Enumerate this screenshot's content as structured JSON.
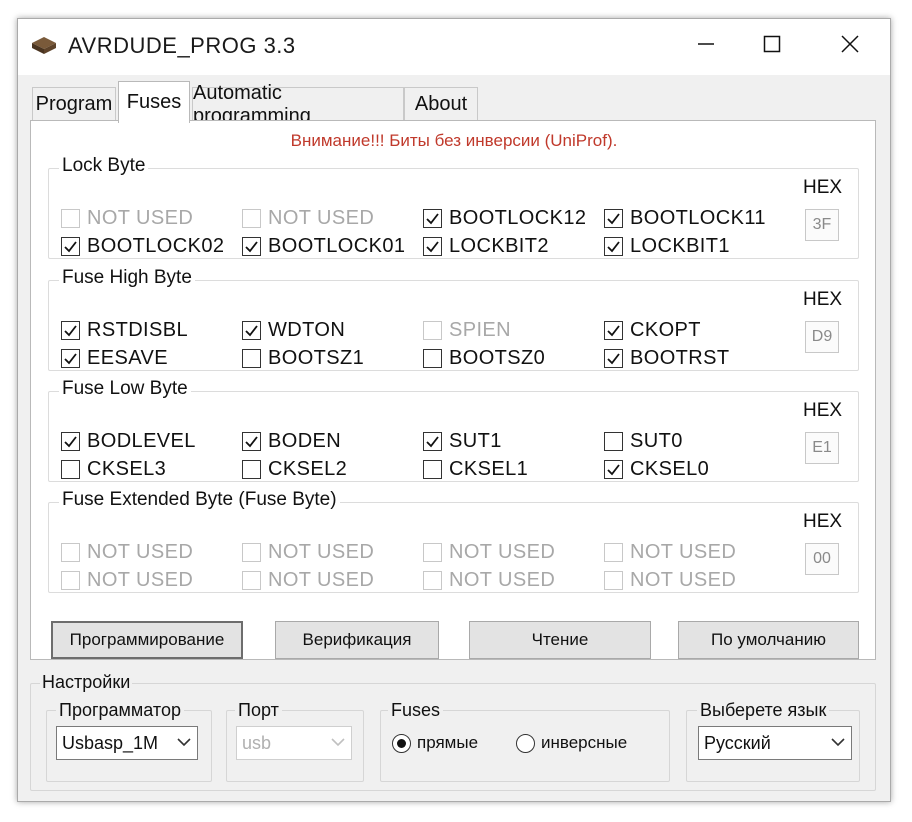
{
  "window": {
    "title": "AVRDUDE_PROG 3.3"
  },
  "tabs": [
    {
      "label": "Program"
    },
    {
      "label": "Fuses"
    },
    {
      "label": "Automatic programming"
    },
    {
      "label": "About"
    }
  ],
  "active_tab": "Fuses",
  "warning": "Внимание!!! Биты без инверсии (UniProf).",
  "hex_label": "HEX",
  "groups": {
    "lock": {
      "title": "Lock Byte",
      "hex": "3F",
      "items": [
        {
          "label": "NOT USED",
          "checked": false,
          "enabled": false
        },
        {
          "label": "NOT USED",
          "checked": false,
          "enabled": false
        },
        {
          "label": "BOOTLOCK12",
          "checked": true,
          "enabled": true
        },
        {
          "label": "BOOTLOCK11",
          "checked": true,
          "enabled": true
        },
        {
          "label": "BOOTLOCK02",
          "checked": true,
          "enabled": true
        },
        {
          "label": "BOOTLOCK01",
          "checked": true,
          "enabled": true
        },
        {
          "label": "LOCKBIT2",
          "checked": true,
          "enabled": true
        },
        {
          "label": "LOCKBIT1",
          "checked": true,
          "enabled": true
        }
      ]
    },
    "high": {
      "title": "Fuse High Byte",
      "hex": "D9",
      "items": [
        {
          "label": "RSTDISBL",
          "checked": true,
          "enabled": true
        },
        {
          "label": "WDTON",
          "checked": true,
          "enabled": true
        },
        {
          "label": "SPIEN",
          "checked": false,
          "enabled": false
        },
        {
          "label": "CKOPT",
          "checked": true,
          "enabled": true
        },
        {
          "label": "EESAVE",
          "checked": true,
          "enabled": true
        },
        {
          "label": "BOOTSZ1",
          "checked": false,
          "enabled": true
        },
        {
          "label": "BOOTSZ0",
          "checked": false,
          "enabled": true
        },
        {
          "label": "BOOTRST",
          "checked": true,
          "enabled": true
        }
      ]
    },
    "low": {
      "title": "Fuse Low Byte",
      "hex": "E1",
      "items": [
        {
          "label": "BODLEVEL",
          "checked": true,
          "enabled": true
        },
        {
          "label": "BODEN",
          "checked": true,
          "enabled": true
        },
        {
          "label": "SUT1",
          "checked": true,
          "enabled": true
        },
        {
          "label": "SUT0",
          "checked": false,
          "enabled": true
        },
        {
          "label": "CKSEL3",
          "checked": false,
          "enabled": true
        },
        {
          "label": "CKSEL2",
          "checked": false,
          "enabled": true
        },
        {
          "label": "CKSEL1",
          "checked": false,
          "enabled": true
        },
        {
          "label": "CKSEL0",
          "checked": true,
          "enabled": true
        }
      ]
    },
    "ext": {
      "title": "Fuse Extended Byte (Fuse Byte)",
      "hex": "00",
      "items": [
        {
          "label": "NOT USED",
          "checked": false,
          "enabled": false
        },
        {
          "label": "NOT USED",
          "checked": false,
          "enabled": false
        },
        {
          "label": "NOT USED",
          "checked": false,
          "enabled": false
        },
        {
          "label": "NOT USED",
          "checked": false,
          "enabled": false
        },
        {
          "label": "NOT USED",
          "checked": false,
          "enabled": false
        },
        {
          "label": "NOT USED",
          "checked": false,
          "enabled": false
        },
        {
          "label": "NOT USED",
          "checked": false,
          "enabled": false
        },
        {
          "label": "NOT USED",
          "checked": false,
          "enabled": false
        }
      ]
    }
  },
  "buttons": {
    "program": "Программирование",
    "verify": "Верификация",
    "read": "Чтение",
    "default": "По умолчанию"
  },
  "settings": {
    "title": "Настройки",
    "programmer": {
      "label": "Программатор",
      "value": "Usbasp_1M"
    },
    "port": {
      "label": "Порт",
      "value": "usb"
    },
    "fuses": {
      "label": "Fuses",
      "option_direct": "прямые",
      "option_inverse": "инверсные",
      "selected": "прямые"
    },
    "language": {
      "label": "Выберете язык",
      "value": "Русский"
    }
  },
  "colors": {
    "warning": "#c0392b",
    "disabled_text": "#a8a8a8"
  }
}
